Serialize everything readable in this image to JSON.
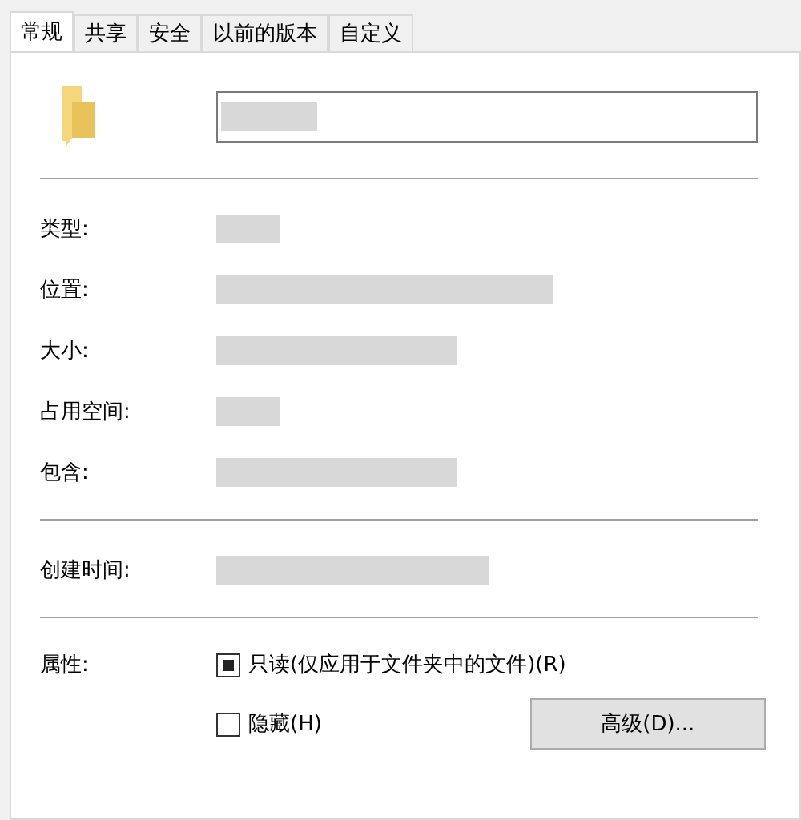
{
  "tabs": [
    {
      "label": "常规",
      "selected": true
    },
    {
      "label": "共享",
      "selected": false
    },
    {
      "label": "安全",
      "selected": false
    },
    {
      "label": "以前的版本",
      "selected": false
    },
    {
      "label": "自定义",
      "selected": false
    }
  ],
  "properties": [
    {
      "label": "类型:"
    },
    {
      "label": "位置:"
    },
    {
      "label": "大小:"
    },
    {
      "label": "占用空间:"
    },
    {
      "label": "包含:"
    }
  ],
  "dates": [
    {
      "label": "创建时间:"
    }
  ],
  "attributes": {
    "label": "属性:",
    "options": [
      {
        "label": "只读(仅应用于文件夹中的文件)(R)",
        "indeterminate": true
      },
      {
        "label": "隐藏(H)",
        "indeterminate": false
      }
    ],
    "button": "高级(D)..."
  }
}
